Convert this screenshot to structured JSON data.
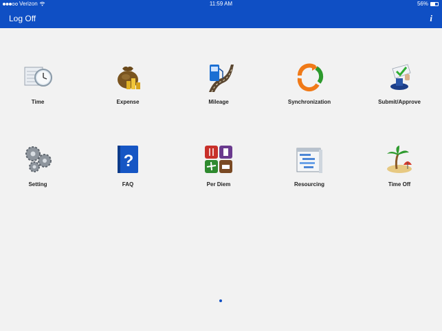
{
  "status": {
    "carrier": "Verizon",
    "time": "11:59 AM",
    "battery": "56%",
    "battery_level": 0.56
  },
  "nav": {
    "logoff_label": "Log Off",
    "info_label": "i"
  },
  "tiles": [
    {
      "label": "Time"
    },
    {
      "label": "Expense"
    },
    {
      "label": "Mileage"
    },
    {
      "label": "Synchronization"
    },
    {
      "label": "Submit/Approve"
    },
    {
      "label": "Setting"
    },
    {
      "label": "FAQ"
    },
    {
      "label": "Per Diem"
    },
    {
      "label": "Resourcing"
    },
    {
      "label": "Time Off"
    }
  ],
  "pager": {
    "pages": 1,
    "current": 1
  }
}
